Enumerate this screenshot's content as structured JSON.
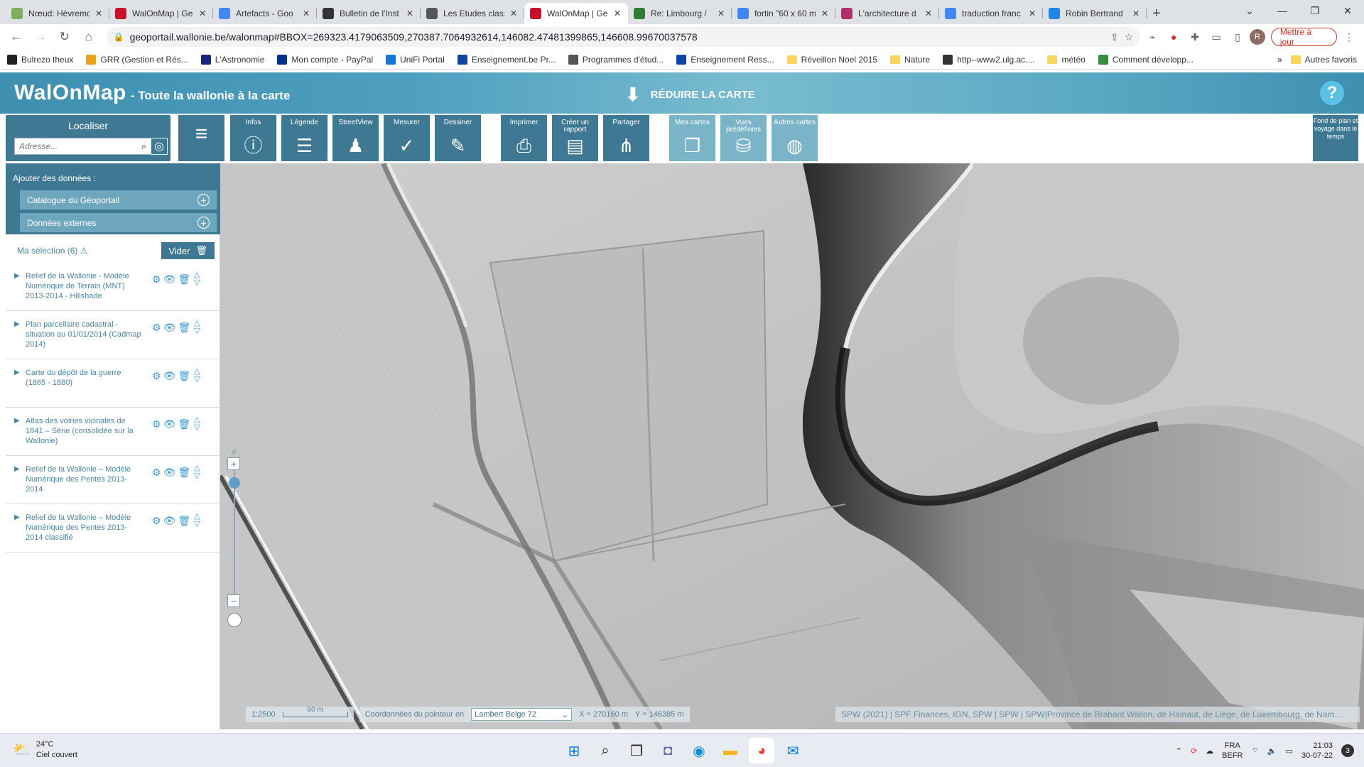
{
  "browser": {
    "tabs": [
      {
        "title": "Nœud: Hèvremo",
        "color": "#7fae5a"
      },
      {
        "title": "WalOnMap | Ge",
        "color": "#c8102e"
      },
      {
        "title": "Artefacts - Goo",
        "color": "#4285f4"
      },
      {
        "title": "Bulletin de l'Inst",
        "color": "#333333"
      },
      {
        "title": "Les Etudes class",
        "color": "#555555"
      },
      {
        "title": "WalOnMap | Ge",
        "color": "#c8102e",
        "active": true
      },
      {
        "title": "Re: Limbourg / ",
        "color": "#2e7d32"
      },
      {
        "title": "fortin \"60 x 60 m",
        "color": "#4285f4"
      },
      {
        "title": "L'architecture d",
        "color": "#b0306a"
      },
      {
        "title": "traduction franc",
        "color": "#4285f4"
      },
      {
        "title": "Robin Bertrand",
        "color": "#1e88e5"
      }
    ],
    "tab_close": "✕",
    "new_tab": "+",
    "url": "geoportail.wallonie.be/walonmap#BBOX=269323.4179063509,270387.7064932614,146082.47481399865,146608.99670037578",
    "update_button": "Mettre à jour",
    "profile_initial": "R",
    "bookmarks": [
      {
        "label": "Bulrezo theux",
        "color": "#222222"
      },
      {
        "label": "GRR (Gestion et Rés...",
        "color": "#e8a317"
      },
      {
        "label": "L'Astronomie",
        "color": "#1a237e"
      },
      {
        "label": "Mon compte - PayPal",
        "color": "#003087"
      },
      {
        "label": "UniFi Portal",
        "color": "#1976d2"
      },
      {
        "label": "Enseignement.be Pr...",
        "color": "#0d47a1"
      },
      {
        "label": "Programmes d'étud...",
        "color": "#555555"
      },
      {
        "label": "Enseignement  Ress...",
        "color": "#0d47a1"
      },
      {
        "label": "Réveillon Noel 2015",
        "color": "folder"
      },
      {
        "label": "Nature",
        "color": "folder"
      },
      {
        "label": "http--www2.ulg.ac....",
        "color": "#333333"
      },
      {
        "label": "météo",
        "color": "folder"
      },
      {
        "label": "Comment développ...",
        "color": "#388e3c"
      }
    ],
    "bookmarks_more": "»",
    "other_bookmarks": "Autres favoris"
  },
  "app": {
    "brand_title": "WalOnMap",
    "brand_subtitle": "- Toute la wallonie à la carte",
    "reduce_map": "RÉDUIRE LA CARTE",
    "help": "?"
  },
  "toolbar": {
    "locate_title": "Localiser",
    "address_placeholder": "Adresse...",
    "buttons": [
      {
        "label": "Infos",
        "icon": "ⓘ"
      },
      {
        "label": "Légende",
        "icon": "☰"
      },
      {
        "label": "StreetView",
        "icon": "♟"
      },
      {
        "label": "Mesurer",
        "icon": "✓"
      },
      {
        "label": "Dessiner",
        "icon": "✎"
      },
      {
        "label": "Imprimer",
        "icon": "⎙"
      },
      {
        "label": "Créer un rapport",
        "icon": "▤"
      },
      {
        "label": "Partager",
        "icon": "⋔"
      },
      {
        "label": "Mes cartes",
        "icon": "❐"
      },
      {
        "label": "Vues prédéfinies",
        "icon": "⛁"
      },
      {
        "label": "Autres cartes",
        "icon": "◍"
      }
    ],
    "fond_de_plan": "Fond de plan et voyage dans le temps"
  },
  "sidebar": {
    "add_data_title": "Ajouter des données :",
    "catalogue": "Catalogue du Géoportail",
    "external": "Données externes",
    "my_selection": "Ma sélection (6)",
    "clear": "Vider",
    "layers": [
      {
        "name": "Relief de la Wallonie - Modèle Numérique de Terrain (MNT) 2013-2014 - Hillshade"
      },
      {
        "name": "Plan parcellaire cadastral - situation au 01/01/2014 (Cadmap 2014)"
      },
      {
        "name": "Carte du dépôt de la guerre (1865 - 1880)"
      },
      {
        "name": "Atlas des voiries vicinales de 1841 – Série (consolidée sur la Wallonie)"
      },
      {
        "name": "Relief de la Wallonie – Modèle Numérique des Pentes 2013-2014"
      },
      {
        "name": "Relief de la Wallonie – Modèle Numérique des Pentes 2013-2014 classifié"
      }
    ]
  },
  "map": {
    "scale": "1:2500",
    "scale_bar": "60 m",
    "coords_label": "Coordonnées du pointeur en",
    "projection": "Lambert Belge 72",
    "x": "X = 270160 m",
    "y": "Y = 146385 m",
    "attribution": "SPW (2021) | SPF Finances, IGN, SPW | SPW | SPW|Province de Brabant Wallon, de Hainaut, de Liège, de Luxembourg, de Nam..."
  },
  "taskbar": {
    "temperature": "24°C",
    "weather": "Ciel couvert",
    "lang1": "FRA",
    "lang2": "BEFR",
    "time": "21:03",
    "date": "30-07-22",
    "notifications": "3"
  }
}
